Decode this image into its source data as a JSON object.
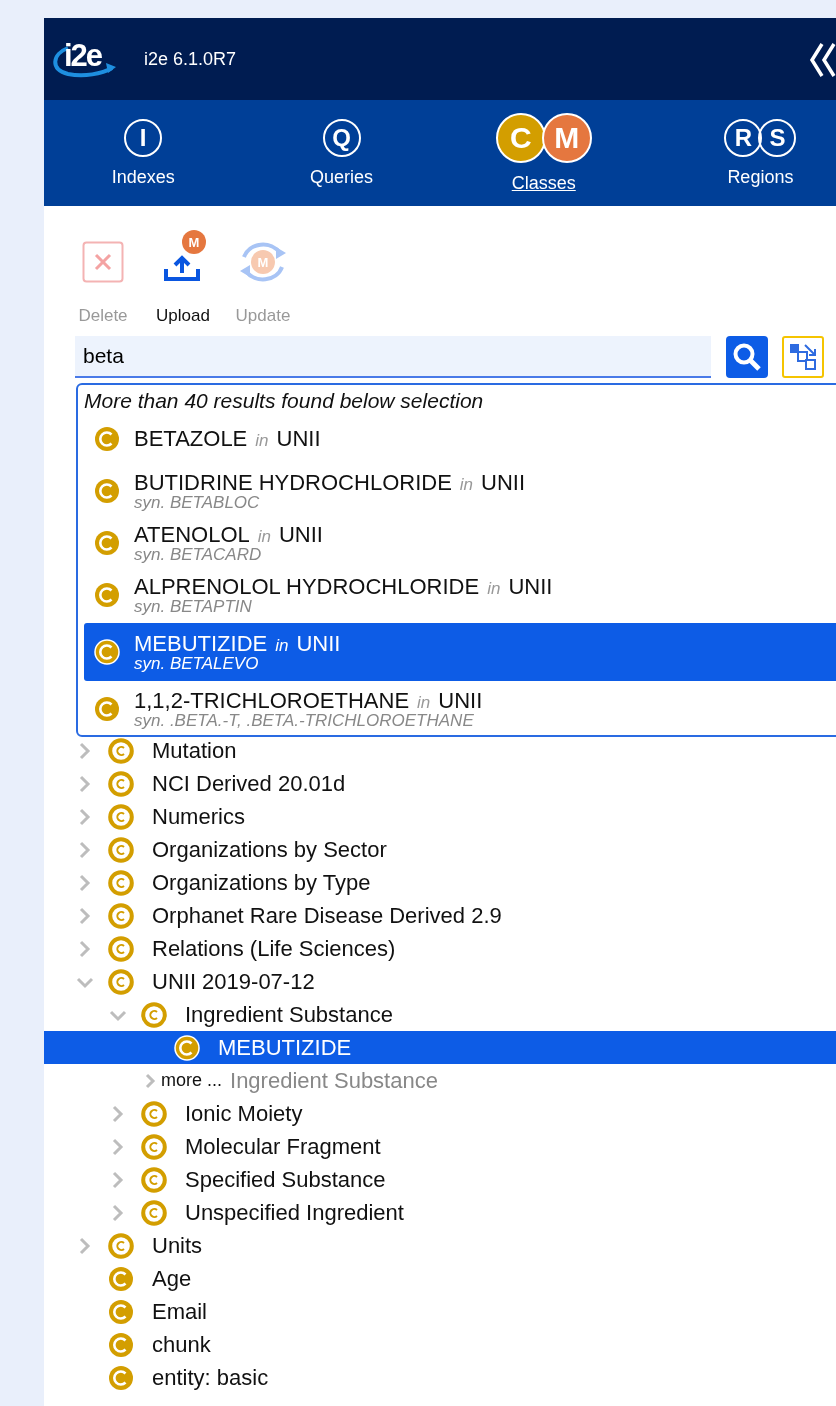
{
  "header": {
    "logo": "i2e",
    "version": "i2e 6.1.0R7"
  },
  "tabs": [
    {
      "label": "Indexes",
      "selected": false,
      "letters": [
        {
          "text": "I"
        }
      ]
    },
    {
      "label": "Queries",
      "selected": false,
      "letters": [
        {
          "text": "Q"
        }
      ]
    },
    {
      "label": "Classes",
      "selected": true,
      "letters": [
        {
          "text": "C",
          "color": "#d39e00"
        },
        {
          "text": "M",
          "color": "#e5773f"
        }
      ]
    },
    {
      "label": "Regions",
      "selected": false,
      "letters": [
        {
          "text": "R"
        },
        {
          "text": "S"
        }
      ]
    }
  ],
  "toolbar": [
    {
      "kind": "delete",
      "label": "Delete",
      "disabled": true
    },
    {
      "kind": "upload",
      "label": "Upload",
      "badge": "M",
      "disabled": false
    },
    {
      "kind": "update",
      "label": "Update",
      "badge": "M",
      "disabled": true
    }
  ],
  "search": {
    "value": "beta"
  },
  "results": {
    "header": "More than 40 results found below selection",
    "items": [
      {
        "name": "BETAZOLE",
        "in": "in",
        "source": "UNII",
        "selected": false
      },
      {
        "name": "BUTIDRINE HYDROCHLORIDE",
        "in": "in",
        "source": "UNII",
        "synonym": "syn. BETABLOC",
        "selected": false
      },
      {
        "name": "ATENOLOL",
        "in": "in",
        "source": "UNII",
        "synonym": "syn. BETACARD",
        "selected": false
      },
      {
        "name": "ALPRENOLOL HYDROCHLORIDE",
        "in": "in",
        "source": "UNII",
        "synonym": "syn. BETAPTIN",
        "selected": false
      },
      {
        "name": "MEBUTIZIDE",
        "in": "in",
        "source": "UNII",
        "synonym": "syn. BETALEVO",
        "selected": true
      },
      {
        "name": "1,1,2-TRICHLOROETHANE",
        "in": "in",
        "source": "UNII",
        "synonym": "syn. .BETA.-T, .BETA.-TRICHLOROETHANE",
        "selected": false
      }
    ]
  },
  "tree": [
    {
      "kind": "branch",
      "label": "Mutation",
      "expanded": false,
      "selected": false
    },
    {
      "kind": "branch",
      "label": "NCI Derived 20.01d",
      "expanded": false,
      "selected": false
    },
    {
      "kind": "branch",
      "label": "Numerics",
      "expanded": false,
      "selected": false
    },
    {
      "kind": "branch",
      "label": "Organizations by Sector",
      "expanded": false,
      "selected": false
    },
    {
      "kind": "branch",
      "label": "Organizations by Type",
      "expanded": false,
      "selected": false
    },
    {
      "kind": "branch",
      "label": "Orphanet Rare Disease Derived 2.9",
      "expanded": false,
      "selected": false
    },
    {
      "kind": "branch",
      "label": "Relations (Life Sciences)",
      "expanded": false,
      "selected": false
    },
    {
      "kind": "branch",
      "label": "UNII 2019-07-12",
      "expanded": true,
      "selected": false,
      "children": [
        {
          "kind": "branch",
          "label": "Ingredient Substance",
          "expanded": true,
          "selected": false,
          "children": [
            {
              "kind": "leaf",
              "label": "MEBUTIZIDE",
              "selected": true
            },
            {
              "kind": "more",
              "prefix": "more ...",
              "label": "Ingredient Substance",
              "selected": false
            }
          ]
        },
        {
          "kind": "branch",
          "label": "Ionic Moiety",
          "expanded": false,
          "selected": false
        },
        {
          "kind": "branch",
          "label": "Molecular Fragment",
          "expanded": false,
          "selected": false
        },
        {
          "kind": "branch",
          "label": "Specified Substance",
          "expanded": false,
          "selected": false
        },
        {
          "kind": "branch",
          "label": "Unspecified Ingredient",
          "expanded": false,
          "selected": false
        }
      ]
    },
    {
      "kind": "branch",
      "label": "Units",
      "expanded": false,
      "selected": false
    },
    {
      "kind": "leaf",
      "label": "Age",
      "selected": false
    },
    {
      "kind": "leaf",
      "label": "Email",
      "selected": false
    },
    {
      "kind": "leaf",
      "label": "chunk",
      "selected": false
    },
    {
      "kind": "leaf",
      "label": "entity: basic",
      "selected": false
    }
  ]
}
